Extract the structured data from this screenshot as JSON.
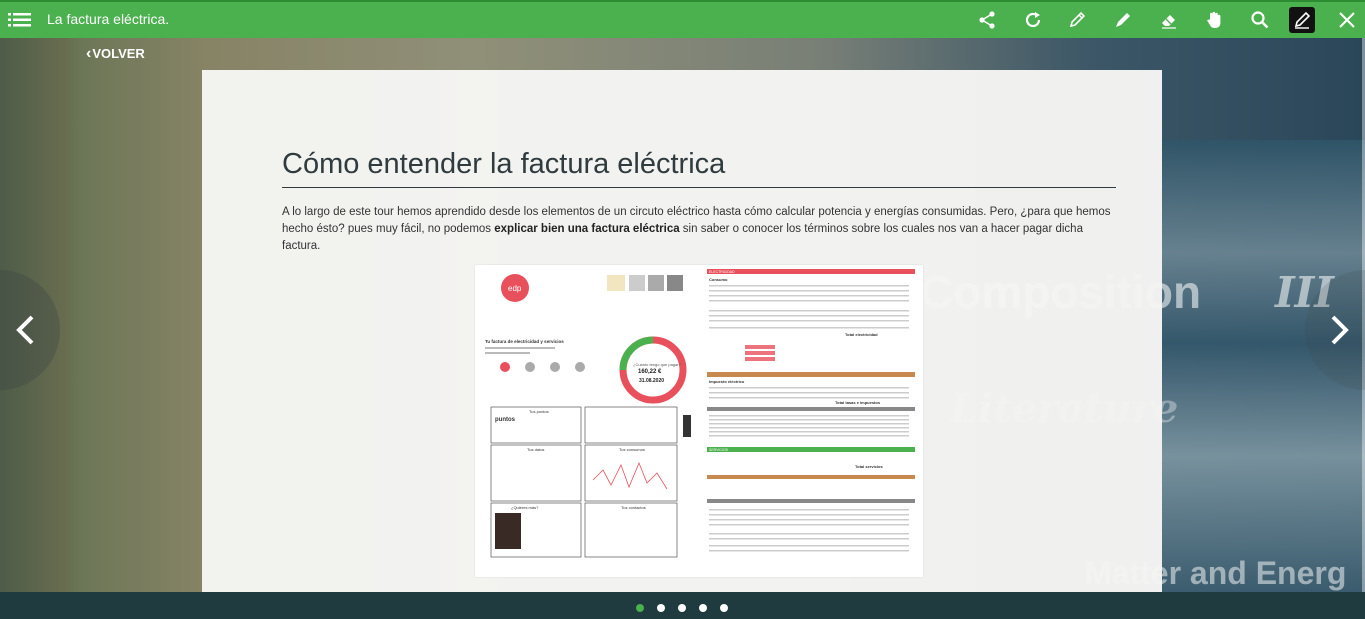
{
  "app": {
    "title": "La factura eléctrica."
  },
  "toolbar": {
    "tools": [
      "share-icon",
      "refresh-icon",
      "pencil-outline-icon",
      "pen-icon",
      "eraser-icon",
      "hand-icon",
      "search-icon",
      "edit-active-icon",
      "close-icon"
    ]
  },
  "nav": {
    "back_label": "VOLVER"
  },
  "card": {
    "title": "Cómo entender la factura eléctrica",
    "paragraph_pre": "A lo largo de este tour hemos aprendido desde los elementos de un circuto eléctrico hasta cómo calcular potencia y energías consumidas. Pero, ¿para que hemos hecho ésto? pues muy fácil, no podemos ",
    "paragraph_bold": "explicar bien una factura eléctrica",
    "paragraph_post": " sin saber o conocer los términos sobre los cuales nos van a hacer pagar dicha factura."
  },
  "invoice": {
    "brand": "edp",
    "amount": "160,22 €",
    "due_label": "¿Cuánto tengo que pagar?",
    "due_date": "31.08.2020",
    "left_heading": "Tu factura de electricidad y servicios",
    "puntos_label": "puntos",
    "tus_puntos": "Tus puntos",
    "tus_datos": "Tus datos",
    "tus_consumos": "Tus consumos",
    "tus_contactos": "Tus contactos",
    "sabes_mas": "¿Quieres más?",
    "right_heading": "ELECTRICIDAD",
    "consumo": "Consumo",
    "total_electricidad": "Total electricidad",
    "impuesto_electrico": "Impuesto eléctrico",
    "total_tasas": "Total tasas e impuestos",
    "servicios": "SERVICIOS",
    "total_servicios": "Total servicios"
  },
  "colors": {
    "topbar": "#4bb04e",
    "bottombar": "#1f3b3f",
    "accent_red": "#e8505b",
    "accent_green": "#4bb04e"
  },
  "pagination": {
    "count": 5,
    "active_index": 0
  }
}
